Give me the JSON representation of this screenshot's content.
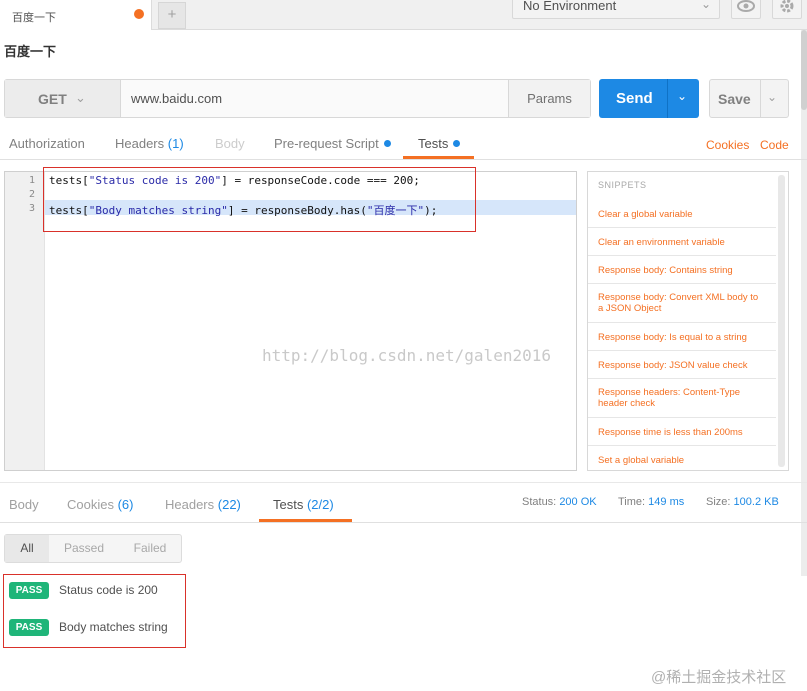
{
  "tabs": [
    {
      "label": "百度一下"
    }
  ],
  "new_tab_label": "+",
  "environment": {
    "selected": "No Environment"
  },
  "request": {
    "name": "百度一下",
    "method": "GET",
    "url": "www.baidu.com",
    "params_label": "Params",
    "send_label": "Send",
    "save_label": "Save"
  },
  "request_tabs": [
    {
      "label": "Authorization"
    },
    {
      "label": "Headers",
      "count": "(1)"
    },
    {
      "label": "Body"
    },
    {
      "label": "Pre-request Script"
    },
    {
      "label": "Tests"
    }
  ],
  "links": {
    "cookies": "Cookies",
    "code": "Code"
  },
  "editor": {
    "line_numbers": [
      "1",
      "2",
      "3"
    ],
    "line1": {
      "a": "tests[",
      "b": "\"Status code is 200\"",
      "c": "] = responseCode.code === 200;"
    },
    "line3": {
      "a": "tests[",
      "b": "\"Body matches string\"",
      "c": "] = responseBody.has(",
      "d": "\"百度一下\"",
      "e": ");"
    }
  },
  "snippets": {
    "title": "SNIPPETS",
    "items": [
      "Clear a global variable",
      "Clear an environment variable",
      "Response body: Contains string",
      "Response body: Convert XML body to a JSON Object",
      "Response body: Is equal to a string",
      "Response body: JSON value check",
      "Response headers: Content-Type header check",
      "Response time is less than 200ms",
      "Set a global variable"
    ]
  },
  "watermark": "http://blog.csdn.net/galen2016",
  "response_tabs": [
    {
      "label": "Body",
      "count": ""
    },
    {
      "label": "Cookies",
      "count": "(6)"
    },
    {
      "label": "Headers",
      "count": "(22)"
    },
    {
      "label": "Tests",
      "count": "(2/2)"
    }
  ],
  "status": {
    "status_label": "Status:",
    "status_value": "200 OK",
    "time_label": "Time:",
    "time_value": "149 ms",
    "size_label": "Size:",
    "size_value": "100.2 KB"
  },
  "filters": [
    "All",
    "Passed",
    "Failed"
  ],
  "results": [
    {
      "badge": "PASS",
      "text": "Status code is 200"
    },
    {
      "badge": "PASS",
      "text": "Body matches string"
    }
  ],
  "footer_mark": "@稀土掘金技术社区",
  "colors": {
    "accent": "#f47023",
    "send": "#1d89e4",
    "pass": "#1fb579",
    "annotation_box": "#d9312a"
  }
}
